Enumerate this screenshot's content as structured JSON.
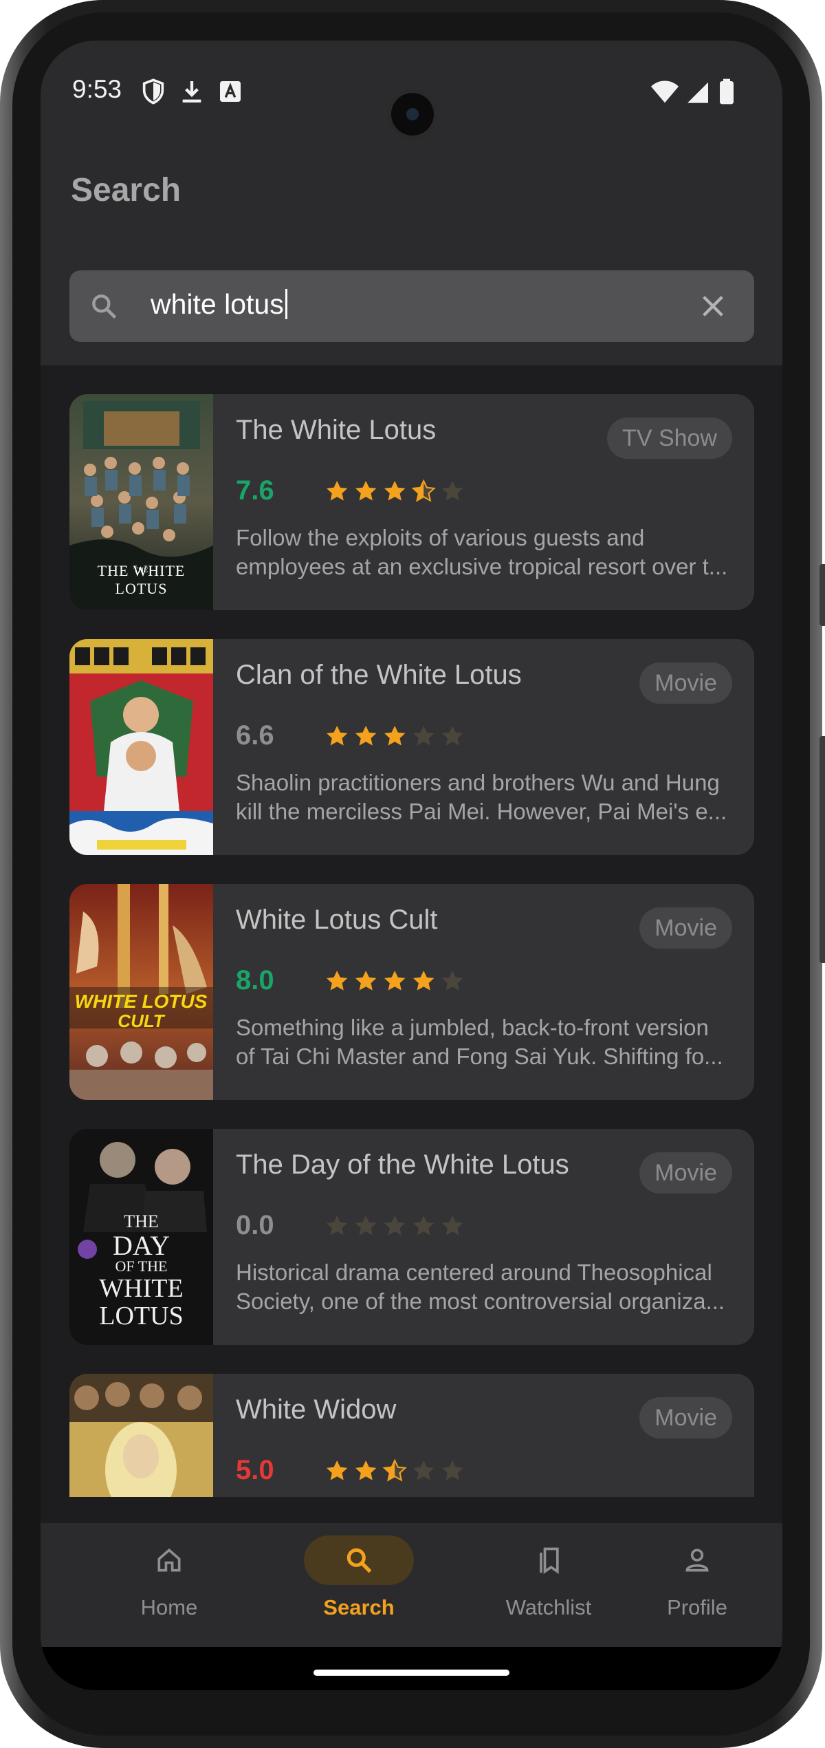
{
  "status_bar": {
    "time": "9:53"
  },
  "header": {
    "title": "Search",
    "search": {
      "value": "white lotus",
      "placeholder": ""
    }
  },
  "results": [
    {
      "title": "The White Lotus",
      "type": "TV Show",
      "rating": "7.6",
      "stars": 3.5,
      "rating_color": "#1aa568",
      "desc_lines": [
        "Follow the exploits of various guests and",
        "employees at an exclusive tropical resort over t..."
      ]
    },
    {
      "title": "Clan of the White Lotus",
      "type": "Movie",
      "rating": "6.6",
      "stars": 3,
      "rating_color": "#8e8e90",
      "desc_lines": [
        "Shaolin practitioners and brothers Wu and Hung",
        "kill the merciless Pai Mei. However, Pai Mei's e..."
      ]
    },
    {
      "title": "White Lotus Cult",
      "type": "Movie",
      "rating": "8.0",
      "stars": 4,
      "rating_color": "#1aa568",
      "desc_lines": [
        "Something like a jumbled, back-to-front version",
        "of Tai Chi Master and Fong Sai Yuk. Shifting fo..."
      ]
    },
    {
      "title": "The Day of the White Lotus",
      "type": "Movie",
      "rating": "0.0",
      "stars": 0,
      "rating_color": "#8e8e90",
      "desc_lines": [
        "Historical drama centered around Theosophical",
        "Society, one of the most controversial organiza..."
      ]
    },
    {
      "title": "White Widow",
      "type": "Movie",
      "rating": "5.0",
      "stars": 2.5,
      "rating_color": "#e53935",
      "desc_lines": [
        "",
        ""
      ]
    }
  ],
  "posters": {
    "p1_text": "THE WHITE LOTUS",
    "p4_lines": [
      "THE",
      "DAY",
      "OF THE",
      "WHITE",
      "LOTUS"
    ]
  },
  "colors": {
    "accent": "#f4a21d",
    "star_empty": "#4b463c"
  },
  "nav": {
    "items": [
      {
        "label": "Home",
        "icon": "home-icon"
      },
      {
        "label": "Search",
        "icon": "search-icon",
        "active": true
      },
      {
        "label": "Watchlist",
        "icon": "bookmarks-icon"
      },
      {
        "label": "Profile",
        "icon": "person-icon"
      }
    ]
  }
}
